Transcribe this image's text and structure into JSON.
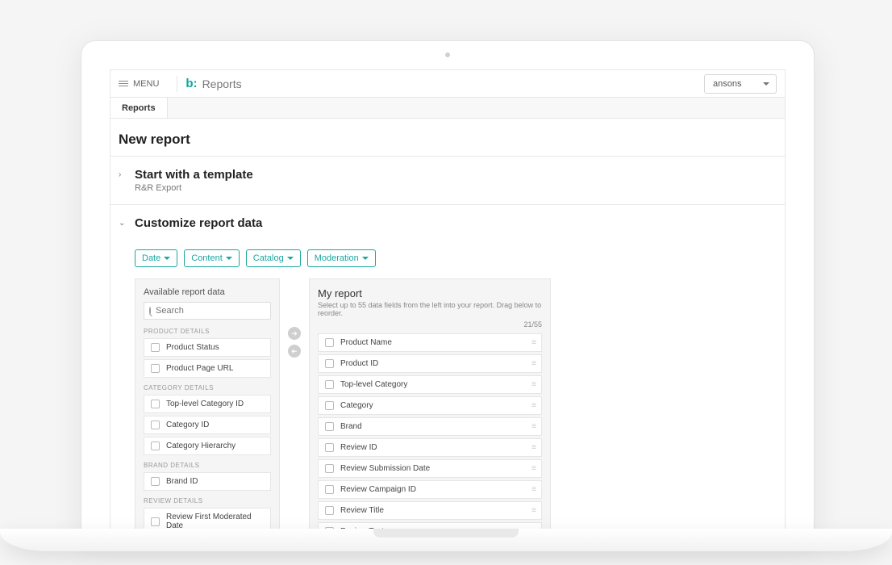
{
  "topbar": {
    "menu_label": "MENU",
    "brand_mark": "b:",
    "brand_title": "Reports",
    "account_selected": "ansons"
  },
  "subnav": {
    "tab_reports": "Reports"
  },
  "page": {
    "title": "New report"
  },
  "panel_template": {
    "title": "Start with a template",
    "subtitle": "R&R Export"
  },
  "panel_customize": {
    "title": "Customize report data"
  },
  "filters": {
    "date": "Date",
    "content": "Content",
    "catalog": "Catalog",
    "moderation": "Moderation"
  },
  "available": {
    "title": "Available report data",
    "search_placeholder": "Search",
    "groups": [
      {
        "label": "PRODUCT DETAILS",
        "fields": [
          "Product Status",
          "Product Page URL"
        ]
      },
      {
        "label": "CATEGORY DETAILS",
        "fields": [
          "Top-level Category ID",
          "Category ID",
          "Category Hierarchy"
        ]
      },
      {
        "label": "BRAND DETAILS",
        "fields": [
          "Brand ID"
        ]
      },
      {
        "label": "REVIEW DETAILS",
        "fields": [
          "Review First Moderated Date"
        ]
      }
    ]
  },
  "my_report": {
    "title": "My report",
    "hint": "Select up to 55 data fields from the left into your report. Drag below to reorder.",
    "count": "21/55",
    "fields": [
      "Product Name",
      "Product ID",
      "Top-level Category",
      "Category",
      "Brand",
      "Review ID",
      "Review Submission Date",
      "Review Campaign ID",
      "Review Title",
      "Review Text"
    ]
  }
}
